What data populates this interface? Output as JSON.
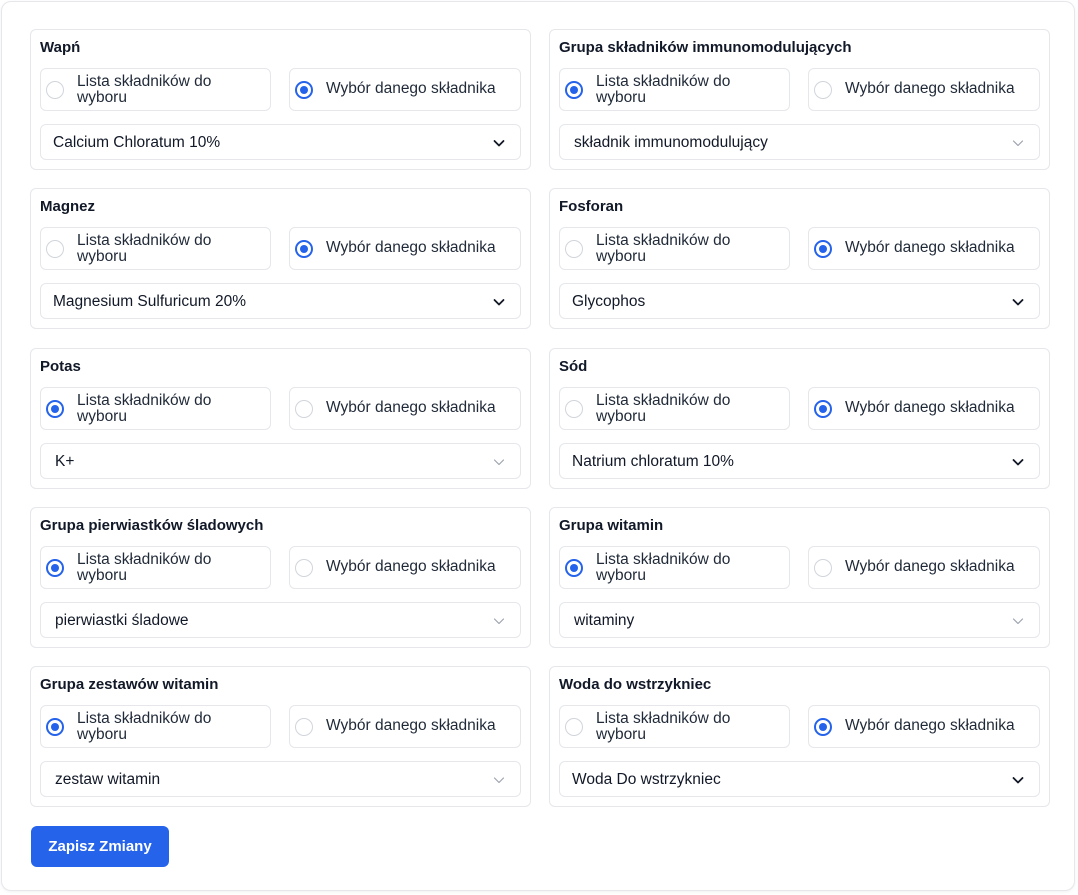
{
  "form": {
    "option_list_label": "Lista składników do wyboru",
    "option_select_label": "Wybór danego składnika",
    "cards": [
      {
        "title": "Wapń",
        "selected": "select",
        "value": "Calcium Chloratum 10%",
        "enabled": true
      },
      {
        "title": "Grupa składników immunomodulujących",
        "selected": "list",
        "value": "składnik immunomodulujący",
        "enabled": false
      },
      {
        "title": "Magnez",
        "selected": "select",
        "value": "Magnesium Sulfuricum 20%",
        "enabled": true
      },
      {
        "title": "Fosforan",
        "selected": "select",
        "value": "Glycophos",
        "enabled": true
      },
      {
        "title": "Potas",
        "selected": "list",
        "value": "K+",
        "enabled": false
      },
      {
        "title": "Sód",
        "selected": "select",
        "value": "Natrium chloratum 10%",
        "enabled": true
      },
      {
        "title": "Grupa pierwiastków śladowych",
        "selected": "list",
        "value": "pierwiastki śladowe",
        "enabled": false
      },
      {
        "title": "Grupa witamin",
        "selected": "list",
        "value": "witaminy",
        "enabled": false
      },
      {
        "title": "Grupa zestawów witamin",
        "selected": "list",
        "value": "zestaw witamin",
        "enabled": false
      },
      {
        "title": "Woda do wstrzykniec",
        "selected": "select",
        "value": "Woda Do wstrzykniec",
        "enabled": true
      }
    ],
    "save_label": "Zapisz Zmiany"
  },
  "colors": {
    "accent": "#2563eb",
    "chevron_active": "#111827",
    "chevron_disabled": "#9ca3af"
  },
  "icons": {
    "radio": "radio-icon",
    "chevron": "chevron-down-icon"
  }
}
